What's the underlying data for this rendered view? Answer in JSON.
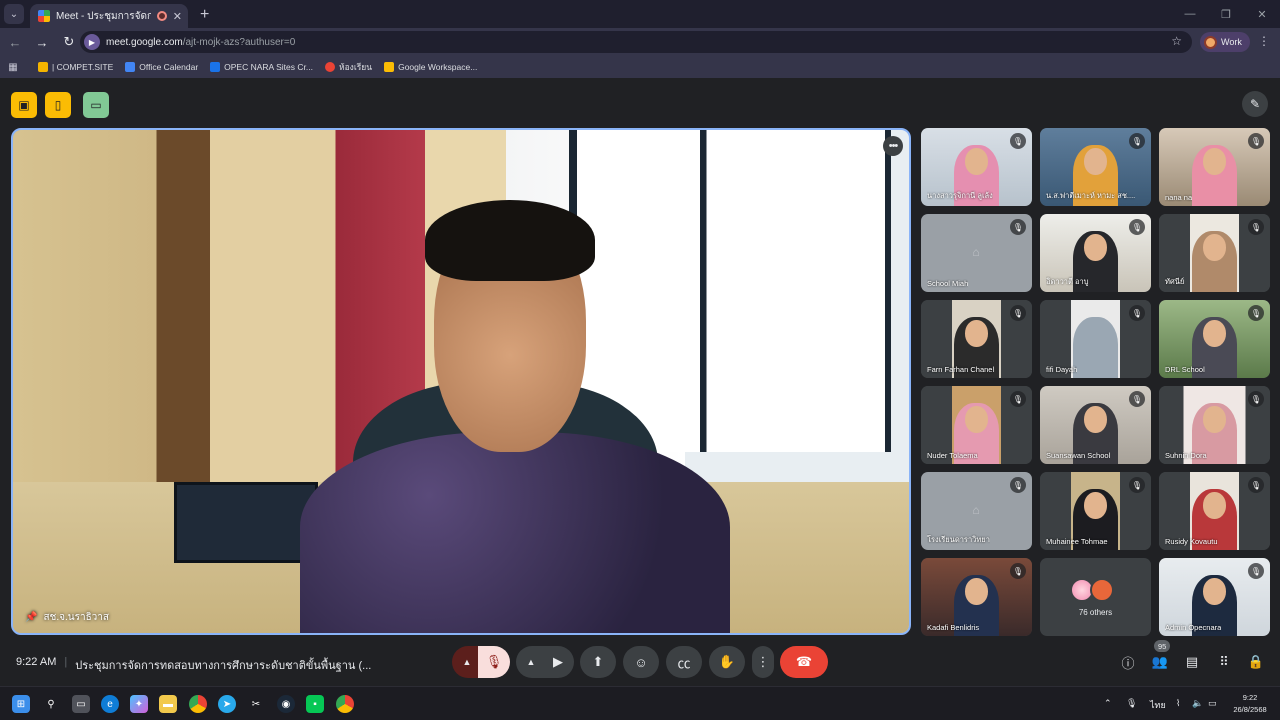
{
  "browser": {
    "tab_title": "Meet - ประชุมการจัดการทดสอ…",
    "url_host": "meet.google.com",
    "url_path": "/ajt-mojk-azs?authuser=0",
    "profile_label": "Work",
    "bookmarks": [
      {
        "label": "| COMPET.SITE",
        "color": "#f4b400"
      },
      {
        "label": "Office Calendar",
        "color": "#4285f4"
      },
      {
        "label": "OPEC NARA Sites Cr...",
        "color": "#1a73e8"
      },
      {
        "label": "ห้องเรียน",
        "color": "#ea4335"
      },
      {
        "label": "Google Workspace...",
        "color": "#fbbc04"
      }
    ]
  },
  "meeting": {
    "time": "9:22 AM",
    "title": "ประชุมการจัดการทดสอบทางการศึกษาระดับชาติขั้นพื้นฐาน (...",
    "presenter_name": "สช.จ.นราธิวาส",
    "participant_count": "95",
    "others_label": "76 others",
    "participants": [
      {
        "name": "นางสาวรุจิกานี ลูเล้ง"
      },
      {
        "name": "น.ส.ฟาตีเมาะห์ หามะ สช...."
      },
      {
        "name": "nana na"
      },
      {
        "name": "School Miah"
      },
      {
        "name": "อิดาวาตี อาบู"
      },
      {
        "name": "ทัศนีย์"
      },
      {
        "name": "Farn Farhan Chanel"
      },
      {
        "name": "fifi Dayah"
      },
      {
        "name": "DRL School"
      },
      {
        "name": "Nuder Tolaema"
      },
      {
        "name": "Suansawan School"
      },
      {
        "name": "Suhnin Dora"
      },
      {
        "name": "โรงเรียนดาราวิทยา"
      },
      {
        "name": "Muhainee Tohmae"
      },
      {
        "name": "Rusidy Kovautu"
      },
      {
        "name": "Kadafi Benlidris"
      },
      {
        "name": "Admin Opecnara"
      }
    ]
  },
  "taskbar": {
    "clock_time": "9:22",
    "clock_date": "26/8/2568",
    "lang": "ไทย"
  },
  "colors": {
    "accent_blue": "#8ab4f8",
    "end_call_red": "#ea4335",
    "activity_yellow": "#fbbc04",
    "activity_green": "#81c995"
  }
}
